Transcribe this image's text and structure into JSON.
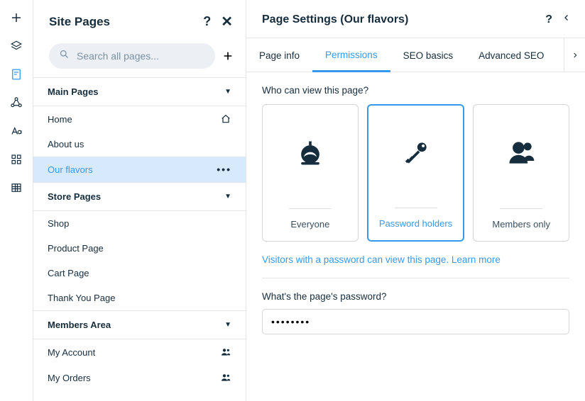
{
  "left": {
    "title": "Site Pages",
    "search_placeholder": "Search all pages...",
    "sections": [
      {
        "label": "Main Pages"
      },
      {
        "label": "Store Pages"
      },
      {
        "label": "Members Area"
      }
    ],
    "main_pages": [
      {
        "label": "Home",
        "icon": "home"
      },
      {
        "label": "About us"
      },
      {
        "label": "Our flavors",
        "selected": true,
        "icon": "dots"
      }
    ],
    "store_pages": [
      {
        "label": "Shop"
      },
      {
        "label": "Product Page"
      },
      {
        "label": "Cart Page"
      },
      {
        "label": "Thank You Page"
      }
    ],
    "members_pages": [
      {
        "label": "My Account",
        "icon": "members"
      },
      {
        "label": "My Orders",
        "icon": "members"
      }
    ]
  },
  "right": {
    "title": "Page Settings (Our flavors)",
    "tabs": [
      {
        "label": "Page info"
      },
      {
        "label": "Permissions",
        "active": true
      },
      {
        "label": "SEO basics"
      },
      {
        "label": "Advanced SEO"
      }
    ],
    "question": "Who can view this page?",
    "options": [
      {
        "label": "Everyone"
      },
      {
        "label": "Password holders",
        "selected": true
      },
      {
        "label": "Members only"
      }
    ],
    "description_lead": "Visitors with a password can view this page. ",
    "description_link": "Learn more",
    "password_label": "What's the page's password?",
    "password_value": "••••••••"
  }
}
